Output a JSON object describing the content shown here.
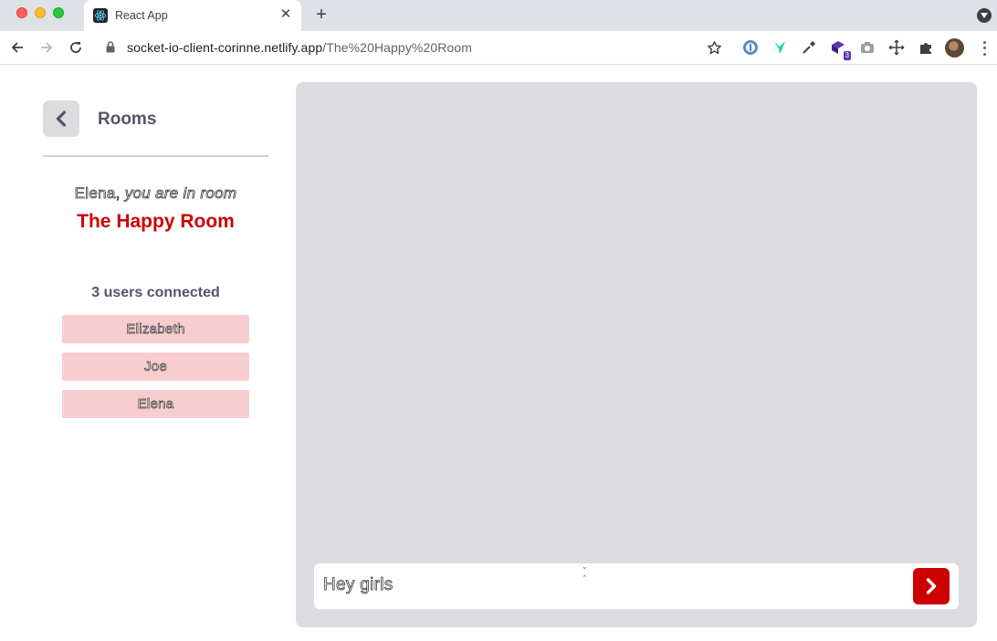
{
  "browser": {
    "tab_title": "React App",
    "new_tab": "+",
    "close_tab": "✕",
    "url_host": "socket-io-client-corinne.netlify.app",
    "url_path": "/The%20Happy%20Room",
    "extension_badge": "3"
  },
  "sidebar": {
    "title": "Rooms",
    "greeting_name": "Elena,",
    "greeting_rest": " you are in room",
    "room_name": "The Happy Room",
    "users_heading": "3 users connected",
    "users": [
      "Elizabeth",
      "Joe",
      "Elena"
    ]
  },
  "chat": {
    "message_value": "Hey girls"
  },
  "colors": {
    "accent": "#cc0000",
    "panel": "#dcdce0",
    "user_chip": "#f7cdcf",
    "heading": "#545468"
  }
}
